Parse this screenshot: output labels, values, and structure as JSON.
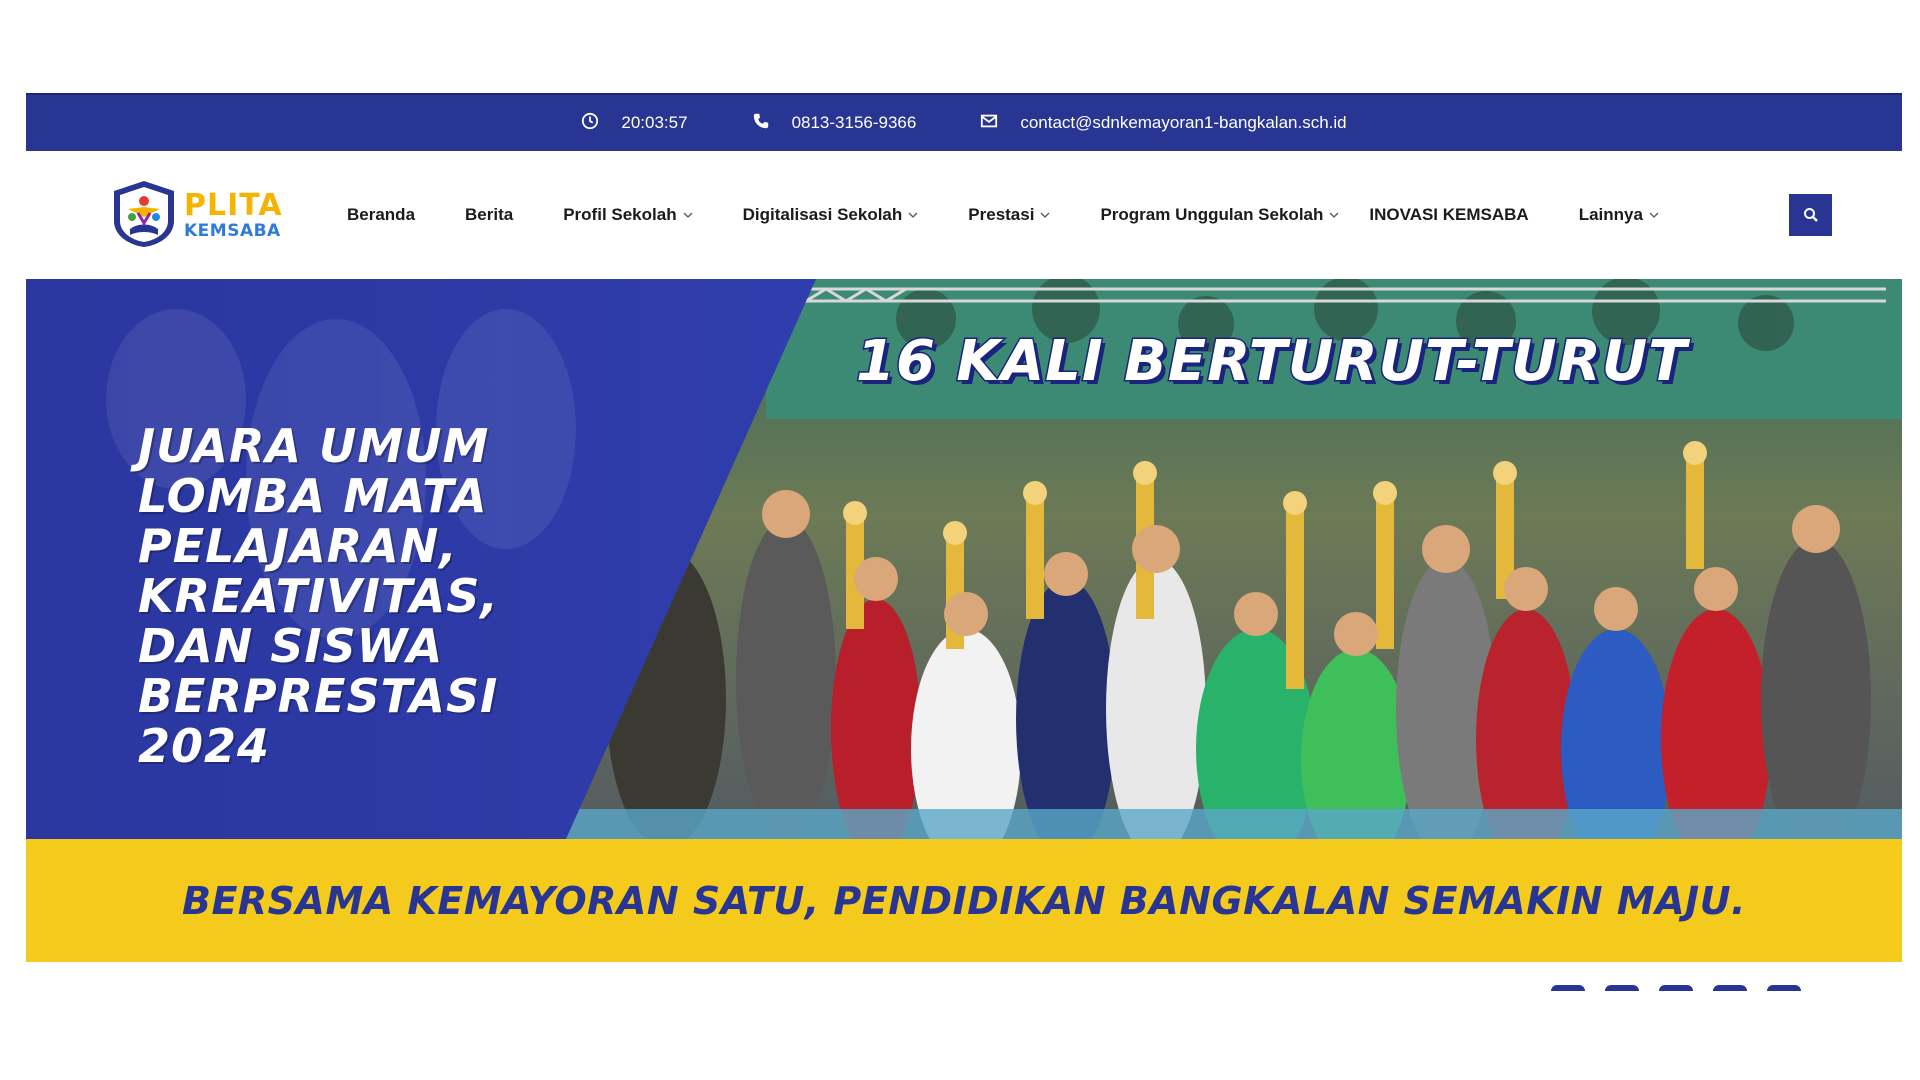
{
  "topbar": {
    "time": "20:03:57",
    "phone": "0813-3156-9366",
    "email": "contact@sdnkemayoran1-bangkalan.sch.id"
  },
  "logo": {
    "line1": "PLITA",
    "line2": "KEMSABA"
  },
  "nav": {
    "items": [
      {
        "label": "Beranda",
        "dropdown": false
      },
      {
        "label": "Berita",
        "dropdown": false
      },
      {
        "label": "Profil Sekolah",
        "dropdown": true
      },
      {
        "label": "Digitalisasi Sekolah",
        "dropdown": true
      },
      {
        "label": "Prestasi",
        "dropdown": true
      },
      {
        "label": "Program Unggulan Sekolah",
        "dropdown": true
      },
      {
        "label": "INOVASI KEMSABA",
        "dropdown": false
      },
      {
        "label": "Lainnya",
        "dropdown": true
      }
    ]
  },
  "hero": {
    "badge": "16 KALI BERTURUT-TURUT",
    "headline": [
      "JUARA UMUM",
      "LOMBA MATA",
      "PELAJARAN,",
      "KREATIVITAS,",
      "DAN SISWA",
      "BERPRESTASI",
      "2024"
    ],
    "tagline": "BERSAMA KEMAYORAN SATU, PENDIDIKAN BANGKALAN SEMAKIN MAJU."
  },
  "colors": {
    "brand_blue": "#283593",
    "accent_yellow": "#f4ca1c",
    "logo_yellow": "#f5b400"
  }
}
